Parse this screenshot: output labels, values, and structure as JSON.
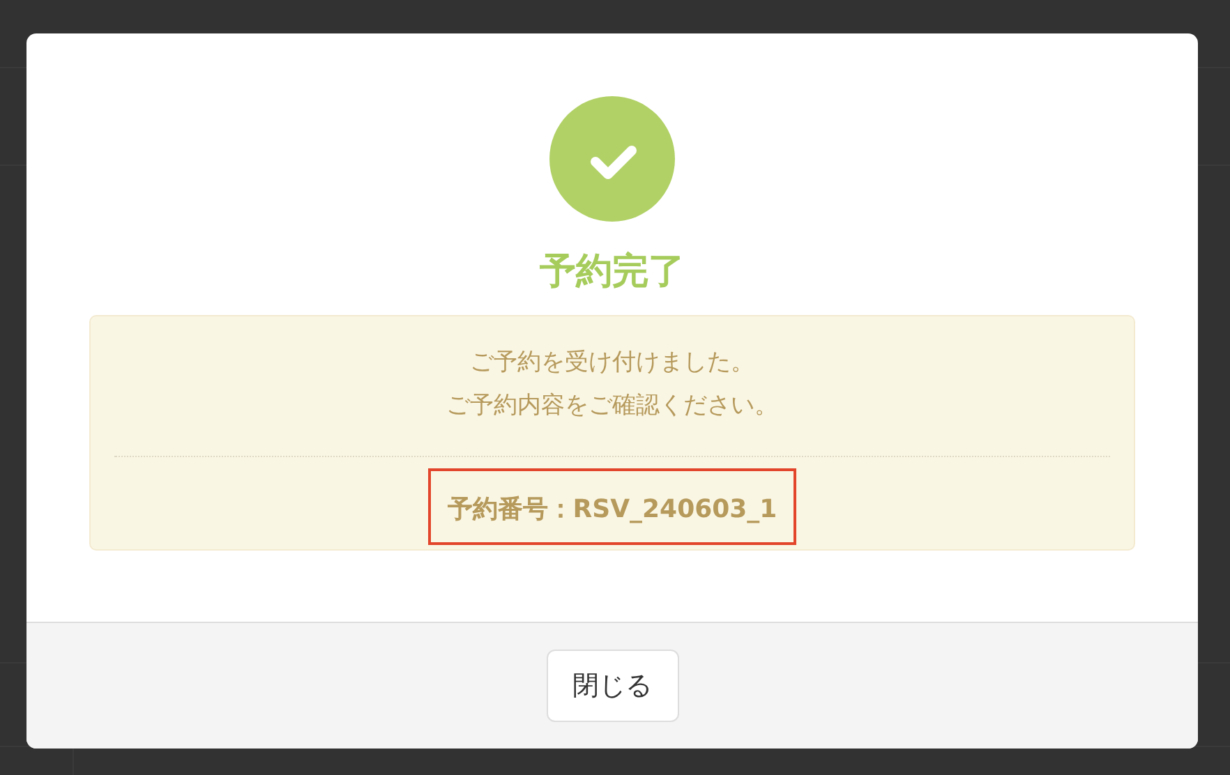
{
  "dialog": {
    "title": "予約完了",
    "kind": "success",
    "message_lines": [
      "ご予約を受け付けました。",
      "ご予約内容をご確認ください。"
    ],
    "reservation_number": {
      "text": "予約番号：RSV_240603_1",
      "highlighted": true
    },
    "buttons": [
      {
        "label": "閉じる"
      }
    ]
  }
}
